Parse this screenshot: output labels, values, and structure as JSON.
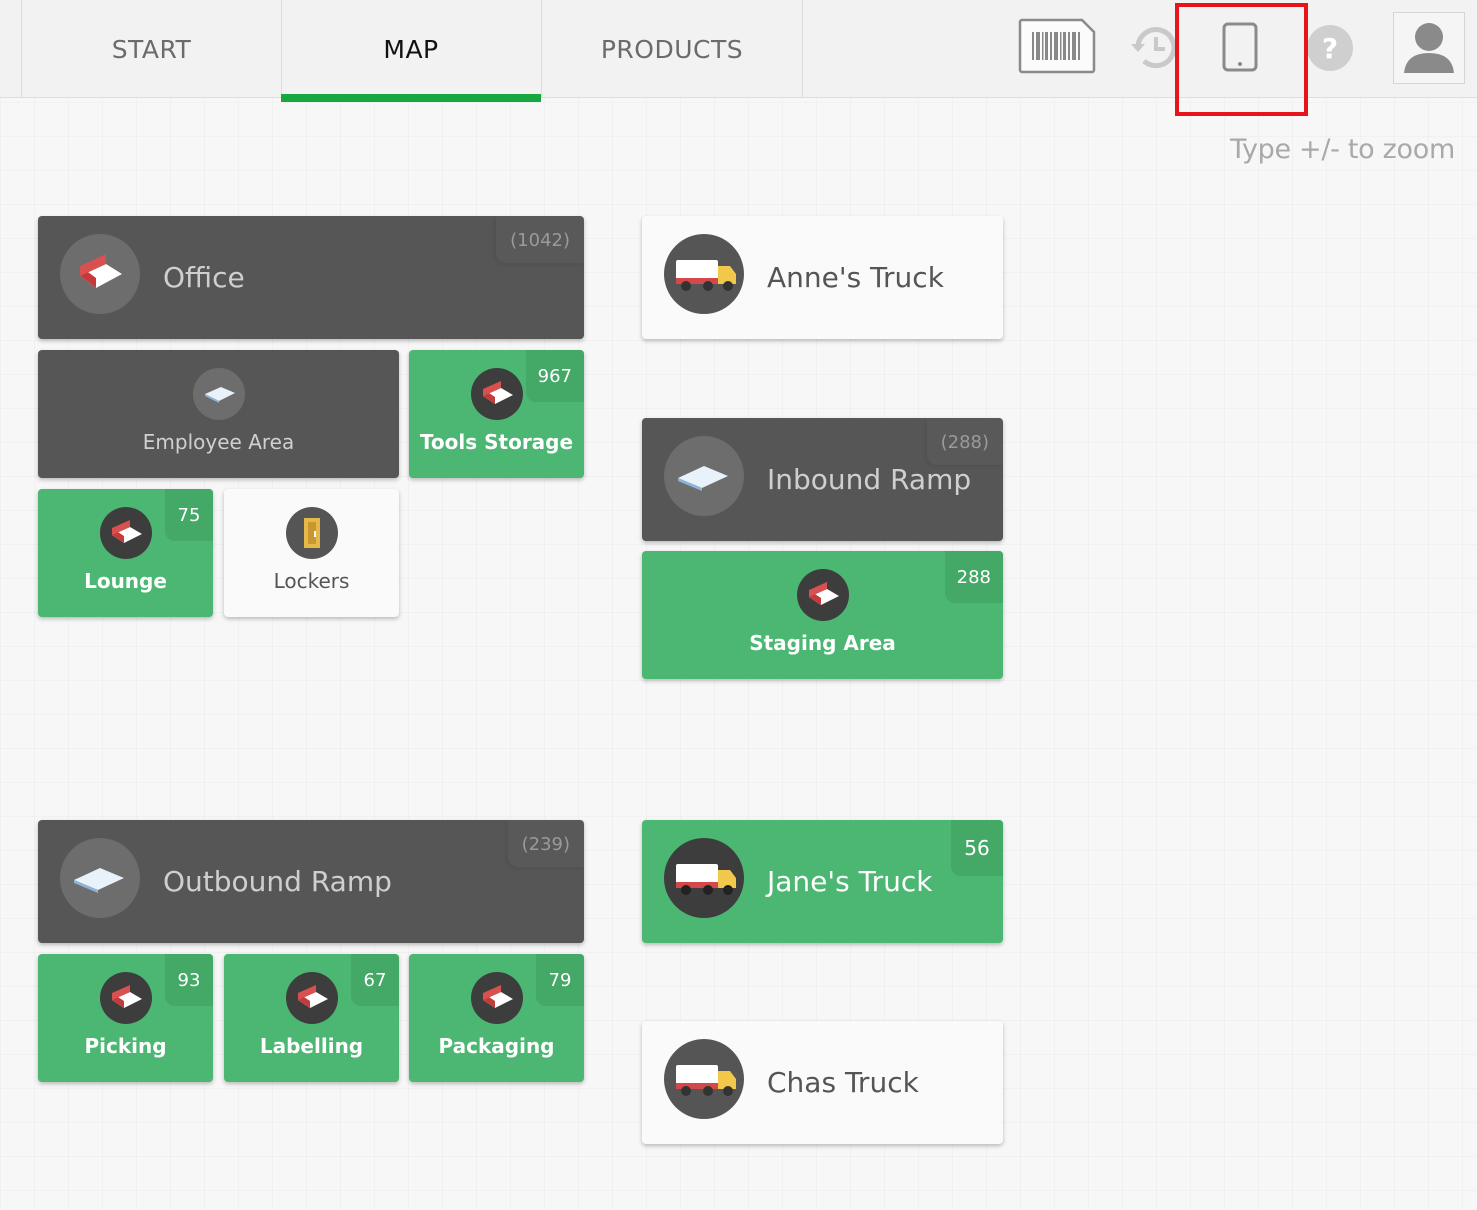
{
  "header": {
    "tabs": [
      {
        "label": "START",
        "active": false
      },
      {
        "label": "MAP",
        "active": true
      },
      {
        "label": "PRODUCTS",
        "active": false
      }
    ],
    "icons": [
      "barcode-icon",
      "history-icon",
      "tablet-icon",
      "help-icon",
      "user-avatar-icon"
    ],
    "highlighted_icon": "tablet-icon",
    "accent_color": "#14a83f",
    "highlight_color": "#e8141b"
  },
  "zoom_hint": "Type +/- to zoom",
  "colors": {
    "dark_card": "#565656",
    "green_card": "#4bb772",
    "white_card": "#fafafa"
  },
  "locations": {
    "office": {
      "title": "Office",
      "count": "(1042)",
      "icon": "room-icon"
    },
    "employee_area": {
      "label": "Employee Area",
      "icon": "floor-icon"
    },
    "tools_storage": {
      "label": "Tools Storage",
      "count": "967",
      "icon": "room-icon"
    },
    "lounge": {
      "label": "Lounge",
      "count": "75",
      "icon": "room-icon"
    },
    "lockers": {
      "label": "Lockers",
      "icon": "locker-icon"
    },
    "annes_truck": {
      "title": "Anne's Truck",
      "icon": "truck-icon"
    },
    "inbound_ramp": {
      "title": "Inbound Ramp",
      "count": "(288)",
      "icon": "floor-icon"
    },
    "staging_area": {
      "label": "Staging Area",
      "count": "288",
      "icon": "room-icon"
    },
    "outbound_ramp": {
      "title": "Outbound Ramp",
      "count": "(239)",
      "icon": "floor-icon"
    },
    "picking": {
      "label": "Picking",
      "count": "93",
      "icon": "room-icon"
    },
    "labelling": {
      "label": "Labelling",
      "count": "67",
      "icon": "room-icon"
    },
    "packaging": {
      "label": "Packaging",
      "count": "79",
      "icon": "room-icon"
    },
    "janes_truck": {
      "title": "Jane's Truck",
      "count": "56",
      "icon": "truck-icon"
    },
    "chas_truck": {
      "title": "Chas Truck",
      "icon": "truck-icon"
    }
  }
}
